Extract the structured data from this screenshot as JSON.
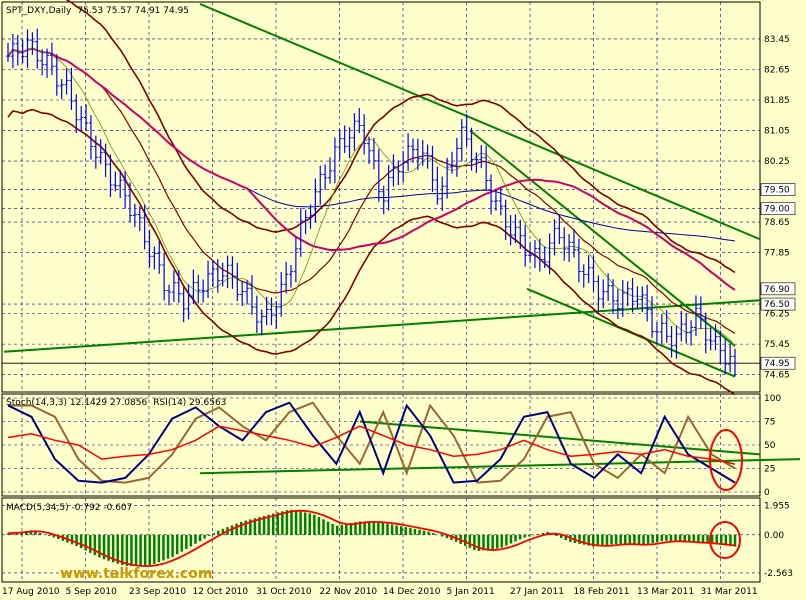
{
  "header": {
    "symbol": "SPT_DXY,Daily",
    "ohlc": "75.53 75.57 74.91 74.95"
  },
  "indicators": {
    "stoch_label": "Stoch(14,3,3) 12.1429 27.0856",
    "rsi_label": "RSI(14) 29.6563",
    "macd_label": "MACD(5,34,5) -0.792 -0.607"
  },
  "watermark": "www.talkforex.com",
  "colors": {
    "background": "#ffffcc",
    "price_bars": "#0000ff",
    "trendline": "#008000",
    "bollinger": "#800000",
    "ma_long": "#000099",
    "ma_mid": "#cc0066",
    "stoch_main": "#000080",
    "stoch_signal": "#996633",
    "rsi": "#ff0000",
    "macd_hist": "#008000",
    "macd_signal": "#ff0000",
    "circle": "#ff0000"
  },
  "chart_data": {
    "type": "candlestick",
    "x_labels": [
      "17 Aug 2010",
      "5 Sep 2010",
      "23 Sep 2010",
      "12 Oct 2010",
      "31 Oct 2010",
      "22 Nov 2010",
      "14 Dec 2010",
      "5 Jan 2011",
      "27 Jan 2011",
      "18 Feb 2011",
      "13 Mar 2011",
      "31 Mar 2011"
    ],
    "price_ticks": [
      "83.45",
      "82.65",
      "81.85",
      "81.05",
      "80.25",
      "79.50",
      "79.00",
      "78.65",
      "77.85",
      "76.50",
      "76.25",
      "75.45",
      "74.65"
    ],
    "price_highlight_labels": [
      "79.50",
      "79.00",
      "76.90",
      "76.50",
      "74.95"
    ],
    "price_range": [
      74.3,
      84.0
    ],
    "last_price": 74.95,
    "price_series": [
      83.0,
      83.3,
      82.8,
      82.1,
      81.0,
      80.0,
      79.3,
      78.2,
      77.0,
      76.6,
      77.1,
      77.4,
      76.8,
      76.0,
      76.9,
      78.6,
      79.8,
      80.8,
      81.2,
      79.3,
      80.3,
      80.6,
      79.3,
      81.0,
      80.2,
      78.9,
      78.2,
      77.6,
      78.4,
      77.6,
      76.9,
      76.6,
      76.8,
      75.8,
      75.6,
      76.2,
      75.4,
      74.95
    ],
    "stoch_ticks": [
      "100",
      "75",
      "50",
      "25",
      "0"
    ],
    "stoch_range": [
      0,
      100
    ],
    "stoch_main": [
      92,
      80,
      35,
      12,
      10,
      15,
      40,
      78,
      90,
      70,
      55,
      85,
      95,
      60,
      30,
      85,
      20,
      92,
      60,
      10,
      12,
      35,
      80,
      85,
      30,
      15,
      40,
      20,
      80,
      40,
      25,
      10
    ],
    "rsi_series": [
      58,
      62,
      55,
      50,
      35,
      38,
      40,
      45,
      55,
      70,
      65,
      60,
      55,
      48,
      58,
      70,
      60,
      50,
      45,
      38,
      40,
      45,
      55,
      45,
      38,
      40,
      43,
      40,
      45,
      38,
      35,
      29.66
    ],
    "macd_ticks": [
      "1.955",
      "0.00",
      "-2.563"
    ],
    "macd_range": [
      -2.9,
      2.2
    ],
    "macd_hist": [
      0.1,
      0.3,
      -0.2,
      -0.8,
      -1.6,
      -2.1,
      -2.1,
      -1.5,
      -0.6,
      0.3,
      0.9,
      1.3,
      1.7,
      1.4,
      0.6,
      0.9,
      0.8,
      0.5,
      0.2,
      -0.4,
      -1.1,
      -0.9,
      -0.2,
      0.2,
      -0.5,
      -0.8,
      -0.6,
      -0.7,
      -0.4,
      -0.5,
      -0.6,
      -0.8
    ]
  }
}
